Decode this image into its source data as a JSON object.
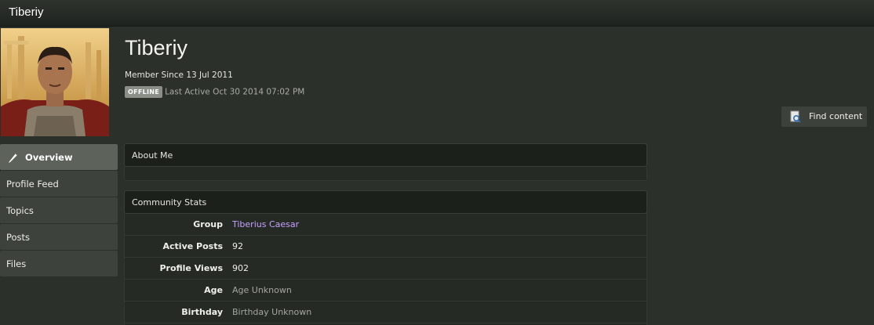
{
  "header": {
    "title": "Tiberiy"
  },
  "profile": {
    "name": "Tiberiy",
    "member_since": "Member Since 13 Jul 2011",
    "status_badge": "OFFLINE",
    "last_active": "Last Active Oct 30 2014 07:02 PM",
    "avatar_icon": "user-avatar-photo"
  },
  "actions": {
    "find_content_label": "Find content",
    "find_content_icon": "search-document-icon"
  },
  "nav": {
    "items": [
      {
        "label": "Overview",
        "active": true,
        "icon": "pencil-icon"
      },
      {
        "label": "Profile Feed"
      },
      {
        "label": "Topics"
      },
      {
        "label": "Posts"
      },
      {
        "label": "Files"
      }
    ]
  },
  "about": {
    "title": "About Me"
  },
  "stats": {
    "title": "Community Stats",
    "rows": [
      {
        "label": "Group",
        "value": "Tiberius Caesar"
      },
      {
        "label": "Active Posts",
        "value": "92"
      },
      {
        "label": "Profile Views",
        "value": "902"
      },
      {
        "label": "Age",
        "value": "Age Unknown"
      },
      {
        "label": "Birthday",
        "value": "Birthday Unknown"
      }
    ]
  },
  "colors": {
    "background": "#2b302a",
    "group_link": "#c7a0ff",
    "nav_active": "#5d625b",
    "panel_header": "#1c201b"
  }
}
